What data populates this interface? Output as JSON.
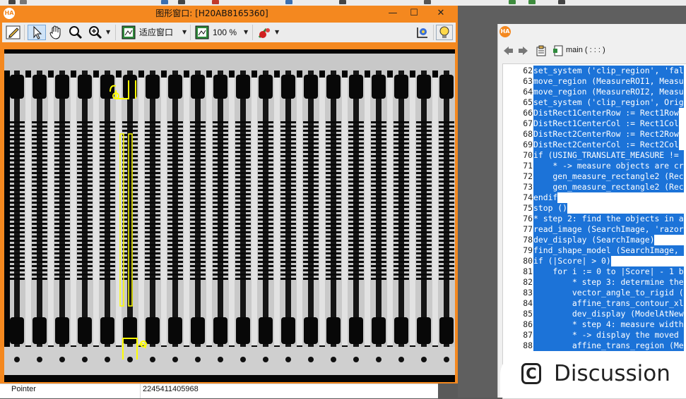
{
  "graphics_window": {
    "title": "图形窗口: [H20AB8165360]",
    "logo": "HA",
    "controls": {
      "minimize": "—",
      "maximize": "☐",
      "close": "✕"
    },
    "toolbar": {
      "tools": [
        "pencil-icon",
        "pointer-icon",
        "hand-icon",
        "zoom-icon",
        "zoom-plus-icon"
      ],
      "fit_label": "适应窗口",
      "zoom_label": "100 %",
      "icons": [
        "fit-window-icon",
        "zoom-percent-icon",
        "color-icon",
        "graphics-settings-icon",
        "help-bulb-icon"
      ]
    },
    "canvas": {
      "background": "#000000",
      "region_color": "#ffff00",
      "object": "comb-shaped printed electronic lead frame"
    }
  },
  "inspector": {
    "name": "Pointer",
    "value": "2245411405968"
  },
  "editor": {
    "logo": "HA",
    "procedure": "main ( : : : )",
    "lines": [
      {
        "no": "62",
        "code": "set_system ('clip_region', 'fal"
      },
      {
        "no": "63",
        "code": "move_region (MeasureROI1, Measu"
      },
      {
        "no": "64",
        "code": "move_region (MeasureROI2, Measu"
      },
      {
        "no": "65",
        "code": "set_system ('clip_region', Orig"
      },
      {
        "no": "66",
        "code": "DistRect1CenterRow := Rect1Row"
      },
      {
        "no": "67",
        "code": "DistRect1CenterCol := Rect1Col"
      },
      {
        "no": "68",
        "code": "DistRect2CenterRow := Rect2Row"
      },
      {
        "no": "69",
        "code": "DistRect2CenterCol := Rect2Col"
      },
      {
        "no": "70",
        "code": "if (USING_TRANSLATE_MEASURE != "
      },
      {
        "no": "71",
        "code": "    * -> measure objects are cr"
      },
      {
        "no": "72",
        "code": "    gen_measure_rectangle2 (Rec"
      },
      {
        "no": "73",
        "code": "    gen_measure_rectangle2 (Rec"
      },
      {
        "no": "74",
        "code": "endif"
      },
      {
        "no": "75",
        "code": "stop ()"
      },
      {
        "no": "76",
        "code": "* step 2: find the objects in a"
      },
      {
        "no": "77",
        "code": "read_image (SearchImage, 'razor"
      },
      {
        "no": "78",
        "code": "dev_display (SearchImage)"
      },
      {
        "no": "79",
        "code": "find_shape_model (SearchImage, "
      },
      {
        "no": "80",
        "code": "if (|Score| > 0)"
      },
      {
        "no": "81",
        "code": "    for i := 0 to |Score| - 1 b"
      },
      {
        "no": "82",
        "code": "        * step 3: determine the"
      },
      {
        "no": "83",
        "code": "        vector_angle_to_rigid ("
      },
      {
        "no": "84",
        "code": "        affine_trans_contour_xl"
      },
      {
        "no": "85",
        "code": "        dev_display (ModelAtNew"
      },
      {
        "no": "86",
        "code": "        * step 4: measure width"
      },
      {
        "no": "87",
        "code": "        * -> display the moved "
      },
      {
        "no": "88",
        "code": "        affine_trans_region (Me"
      }
    ]
  },
  "discussion": {
    "label": "Discussion",
    "icon": "C"
  },
  "colors": {
    "accent": "#f4881f",
    "selection": "#1c73d8",
    "region": "#ffff00"
  }
}
